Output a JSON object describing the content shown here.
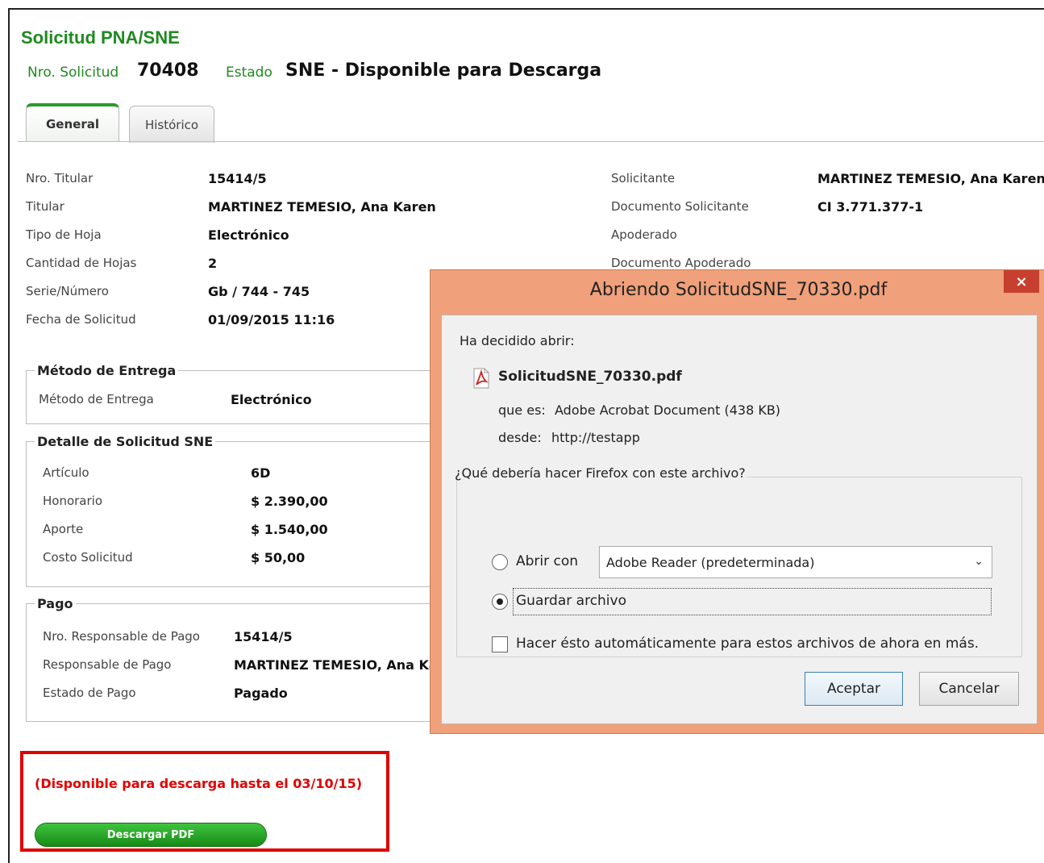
{
  "header": {
    "title": "Solicitud PNA/SNE",
    "nro_label": "Nro. Solicitud",
    "nro_value": "70408",
    "estado_label": "Estado",
    "estado_value": "SNE - Disponible para Descarga"
  },
  "tabs": [
    {
      "label": "General"
    },
    {
      "label": "Histórico"
    }
  ],
  "fields_left": [
    {
      "label": "Nro. Titular",
      "value": "15414/5"
    },
    {
      "label": "Titular",
      "value": "MARTINEZ TEMESIO, Ana Karen"
    },
    {
      "label": "Tipo de Hoja",
      "value": "Electrónico"
    },
    {
      "label": "Cantidad de Hojas",
      "value": "2"
    },
    {
      "label": "Serie/Número",
      "value": "Gb / 744 - 745"
    },
    {
      "label": "Fecha de Solicitud",
      "value": "01/09/2015 11:16"
    }
  ],
  "fields_right": [
    {
      "label": "Solicitante",
      "value": "MARTINEZ TEMESIO, Ana Karen"
    },
    {
      "label": "Documento Solicitante",
      "value": "CI 3.771.377-1"
    },
    {
      "label": "Apoderado",
      "value": ""
    },
    {
      "label": "Documento Apoderado",
      "value": ""
    }
  ],
  "entrega": {
    "legend": "Método de Entrega",
    "label": "Método de Entrega",
    "value": "Electrónico"
  },
  "detalle": {
    "legend": "Detalle de Solicitud SNE",
    "rows": [
      {
        "label": "Artículo",
        "value": "6D"
      },
      {
        "label": "Honorario",
        "value": "$ 2.390,00"
      },
      {
        "label": "Aporte",
        "value": "$ 1.540,00"
      },
      {
        "label": "Costo Solicitud",
        "value": "$ 50,00"
      }
    ]
  },
  "pago": {
    "legend": "Pago",
    "rows": [
      {
        "label": "Nro. Responsable de Pago",
        "value": "15414/5"
      },
      {
        "label": "Responsable de Pago",
        "value": "MARTINEZ TEMESIO, Ana Karen"
      },
      {
        "label": "Estado de Pago",
        "value": "Pagado"
      }
    ]
  },
  "download": {
    "notice": "(Disponible para descarga hasta el 03/10/15)",
    "button_label": "Descargar PDF"
  },
  "dialog": {
    "title": "Abriendo SolicitudSNE_70330.pdf",
    "close": "×",
    "intro": "Ha decidido abrir:",
    "filename": "SolicitudSNE_70330.pdf",
    "type_label": "que es:",
    "type_value": "Adobe Acrobat Document (438 KB)",
    "from_label": "desde:",
    "from_value": "http://testapp",
    "group_legend": "¿Qué debería hacer Firefox con este archivo?",
    "open_with_label": "Abrir con",
    "open_with_app": "Adobe Reader  (predeterminada)",
    "save_label": "Guardar archivo",
    "auto_label": "Hacer ésto automáticamente para estos archivos de ahora en más.",
    "accept_label": "Aceptar",
    "cancel_label": "Cancelar"
  },
  "colors": {
    "brand_green": "#1f8a1f",
    "alert_red": "#e00000",
    "dialog_frame": "#f0a07a",
    "close_red": "#c7402f"
  }
}
